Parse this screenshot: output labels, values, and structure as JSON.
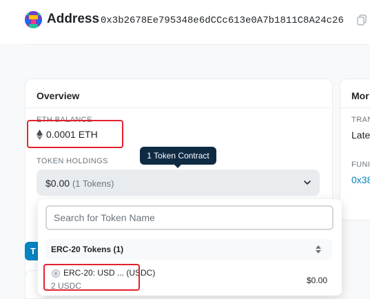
{
  "header": {
    "title": "Address",
    "address": "0x3b2678Ee795348e6dCCc613e0A7b1811C8A24c26"
  },
  "overview": {
    "title": "Overview",
    "eth_balance_label": "ETH BALANCE",
    "eth_balance_value": "0.0001 ETH",
    "token_holdings_label": "TOKEN HOLDINGS",
    "holdings_value": "$0.00",
    "holdings_count": "(1 Tokens)",
    "tooltip": "1 Token Contract"
  },
  "more_info": {
    "title": "Mor",
    "transactions_label": "TRAN",
    "transactions_value": "Late",
    "funded_label": "FUNI",
    "funded_value": "0x38"
  },
  "tab_peek": "T",
  "dropdown": {
    "search_placeholder": "Search for Token Name",
    "group_label": "ERC-20 Tokens (1)",
    "tokens": [
      {
        "name": "ERC-20: USD ... (USDC)",
        "balance": "2 USDC",
        "value": "$0.00"
      }
    ]
  },
  "colors": {
    "highlight": "#e4202c",
    "tooltip_bg": "#0f2a43",
    "link": "#0784c3"
  }
}
